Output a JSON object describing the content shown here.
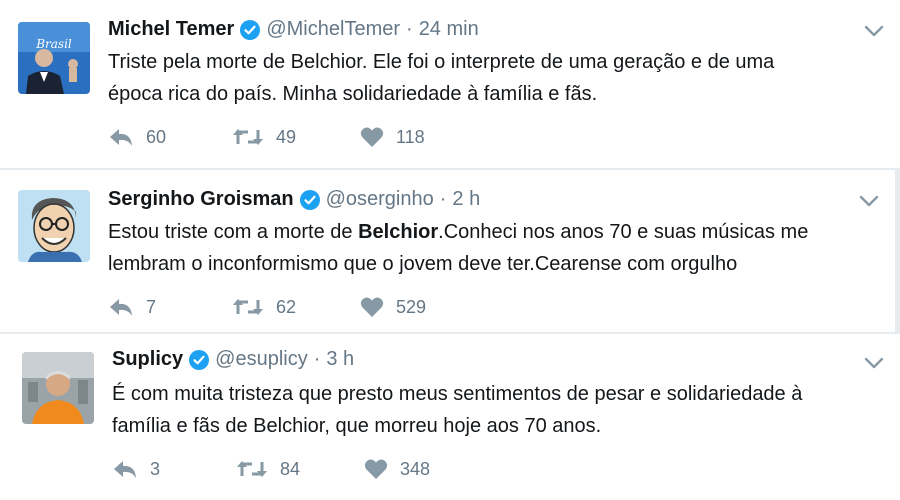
{
  "tweets": [
    {
      "name": "Michel Temer",
      "handle": "@MichelTemer",
      "separator": "·",
      "time": "24 min",
      "text_lines": [
        "Triste pela morte de Belchior. Ele foi o interprete de uma geração e de uma",
        "época rica do país. Minha solidariedade à família e fãs."
      ],
      "replies": "60",
      "retweets": "49",
      "likes": "118",
      "avatar_icon": "temer-avatar"
    },
    {
      "name": "Serginho Groisman",
      "handle": "@oserginho",
      "separator": "·",
      "time": "2 h",
      "text_line1_pre": "Estou triste com a morte de ",
      "text_line1_bold": "Belchior",
      "text_line1_post": ".Conheci nos anos 70 e suas músicas me",
      "text_line2": "lembram o inconformismo que o jovem deve ter.Cearense com orgulho",
      "replies": "7",
      "retweets": "62",
      "likes": "529",
      "avatar_icon": "serginho-caricature-avatar"
    },
    {
      "name": "Suplicy",
      "handle": "@esuplicy",
      "separator": "·",
      "time": "3 h",
      "text_lines": [
        "É com muita tristeza que presto meus sentimentos de pesar e solidariedade à",
        "família e fãs de Belchior, que morreu hoje aos 70 anos."
      ],
      "replies": "3",
      "retweets": "84",
      "likes": "348",
      "avatar_icon": "suplicy-avatar"
    }
  ],
  "colors": {
    "verified_blue": "#1da1f2",
    "muted_gray": "#657786",
    "text_dark": "#14171a"
  }
}
